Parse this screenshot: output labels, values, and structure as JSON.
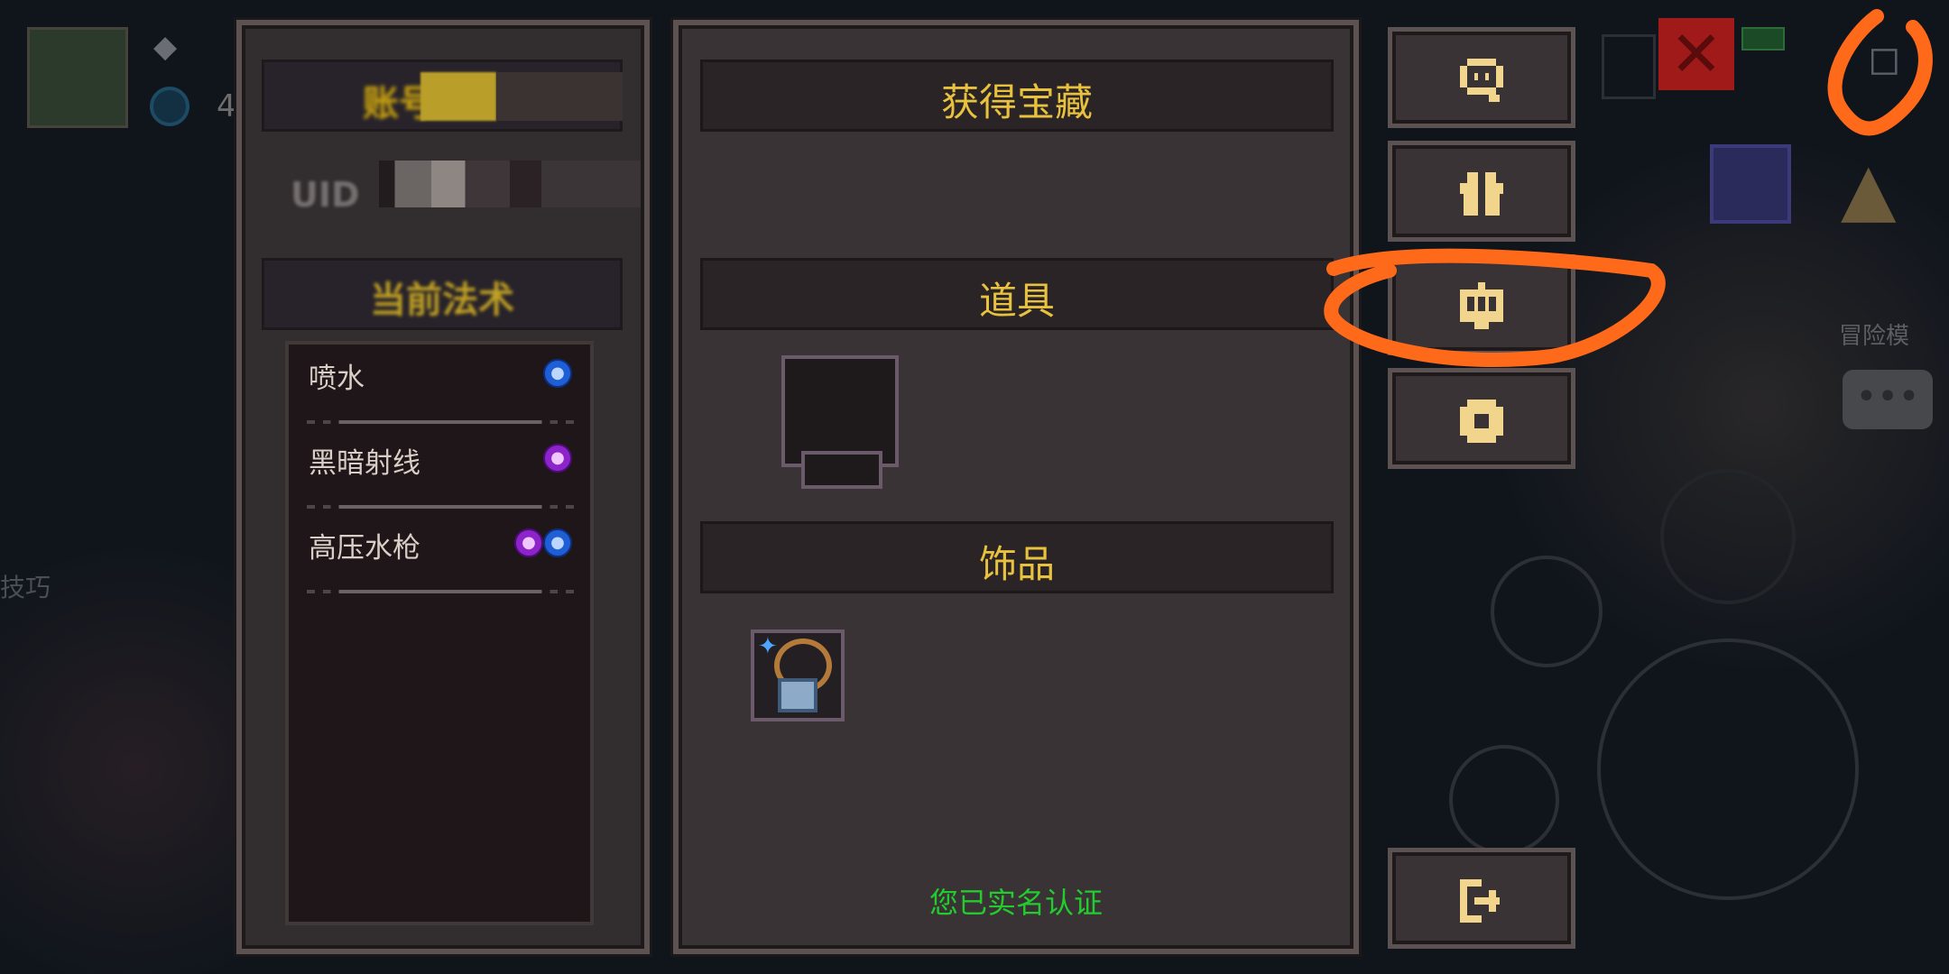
{
  "account": {
    "label": "账号",
    "uid_label": "UID"
  },
  "spells": {
    "header": "当前法术",
    "items": [
      {
        "name": "喷水",
        "elements": [
          "water"
        ]
      },
      {
        "name": "黑暗射线",
        "elements": [
          "dark"
        ]
      },
      {
        "name": "高压水枪",
        "elements": [
          "dark",
          "water"
        ]
      }
    ]
  },
  "treasure": {
    "title": "获得宝藏",
    "props_title": "道具",
    "accessory_title": "饰品",
    "verified_text": "您已实名认证"
  },
  "side_buttons": [
    {
      "icon": "support-headset-icon"
    },
    {
      "icon": "gift-icon"
    },
    {
      "icon": "monster-codex-icon"
    },
    {
      "icon": "settings-gear-icon"
    },
    {
      "icon": "exit-icon"
    }
  ],
  "background_hud": {
    "coin_count": "4",
    "mode_label": "冒险模",
    "tip_label": "技巧"
  },
  "colors": {
    "gold_text": "#e8c23e",
    "verified_green": "#22cc2e",
    "annotation_orange": "#ff6a1a",
    "water_element": "#1f5fd6",
    "dark_element": "#8d24c9"
  }
}
